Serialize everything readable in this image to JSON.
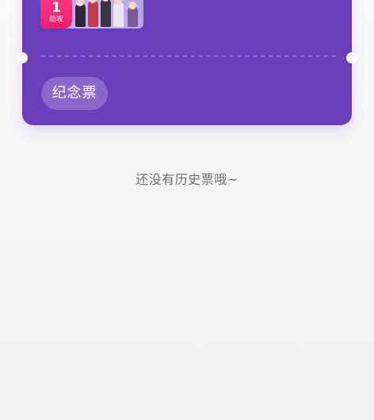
{
  "ticket": {
    "rank_number": "1",
    "rank_label": "助攻",
    "tag_label": "纪念票"
  },
  "empty_state": {
    "message": "还没有历史票哦~"
  },
  "colors": {
    "ticket_background": "#6a3dba",
    "rank_badge": "#ec1f6c",
    "page_background": "#f2f3f5",
    "empty_text": "#6d6d72"
  }
}
